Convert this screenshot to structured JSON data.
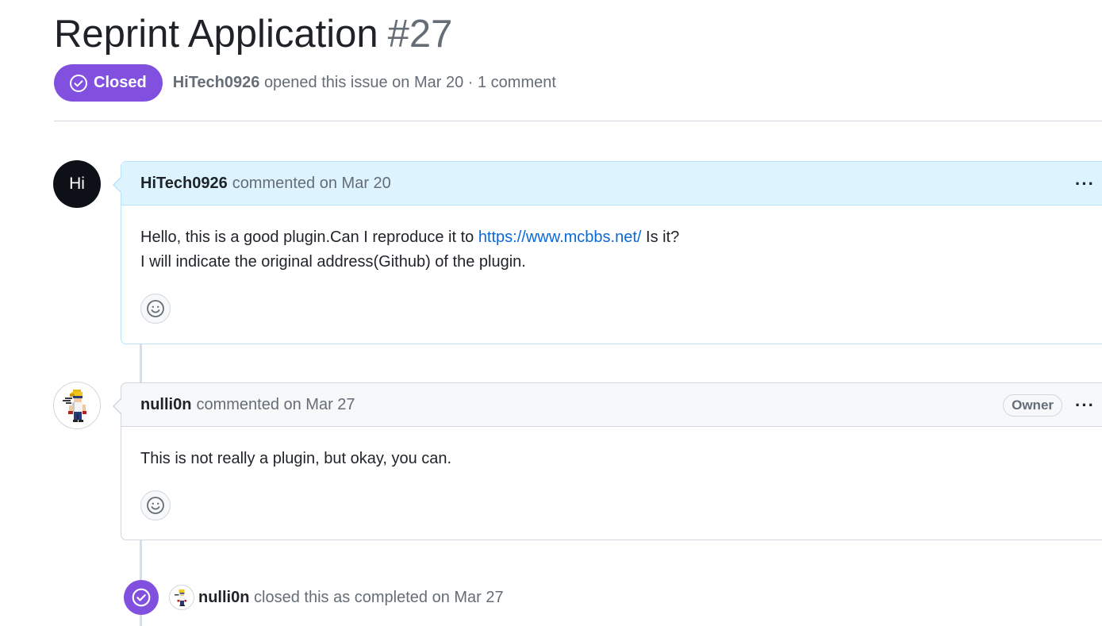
{
  "issue": {
    "title": "Reprint Application",
    "number": "#27",
    "state": "Closed",
    "author": "HiTech0926",
    "opened_text": "opened this issue on Mar 20 · 1 comment"
  },
  "comments": [
    {
      "author": "HiTech0926",
      "avatar_text": "Hi",
      "meta": "commented on Mar 20",
      "body_line1_before": "Hello, this is a good plugin.Can I reproduce it to ",
      "body_link": "https://www.mcbbs.net/",
      "body_line1_after": " Is it?",
      "body_line2": "I will indicate the original address(Github) of the plugin."
    },
    {
      "author": "nulli0n",
      "meta": "commented on Mar 27",
      "badge": "Owner",
      "body": "This is not really a plugin, but okay, you can."
    }
  ],
  "event": {
    "actor": "nulli0n",
    "text": "closed this as completed on Mar 27"
  },
  "colors": {
    "closed_purple": "#8250df",
    "link_blue": "#0969da",
    "author_comment_bg": "#ddf4ff"
  }
}
